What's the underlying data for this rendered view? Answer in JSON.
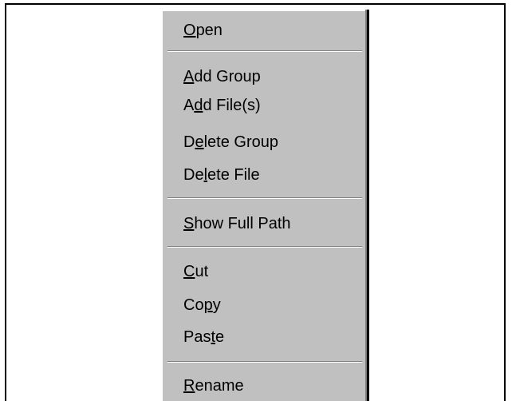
{
  "context_menu": {
    "items": [
      {
        "pre": "",
        "key": "O",
        "post": "pen"
      },
      {
        "pre": "",
        "key": "A",
        "post": "dd Group"
      },
      {
        "pre": "A",
        "key": "d",
        "post": "d File(s)"
      },
      {
        "pre": "D",
        "key": "e",
        "post": "lete Group"
      },
      {
        "pre": "De",
        "key": "l",
        "post": "ete File"
      },
      {
        "pre": "",
        "key": "S",
        "post": "how Full Path"
      },
      {
        "pre": "",
        "key": "C",
        "post": "ut"
      },
      {
        "pre": "Co",
        "key": "p",
        "post": "y"
      },
      {
        "pre": "Pas",
        "key": "t",
        "post": "e"
      },
      {
        "pre": "",
        "key": "R",
        "post": "ename"
      }
    ]
  },
  "colors": {
    "menu_background": "#c0c0c0",
    "text": "#000000",
    "separator_dark": "#808080",
    "separator_light": "#ffffff"
  }
}
